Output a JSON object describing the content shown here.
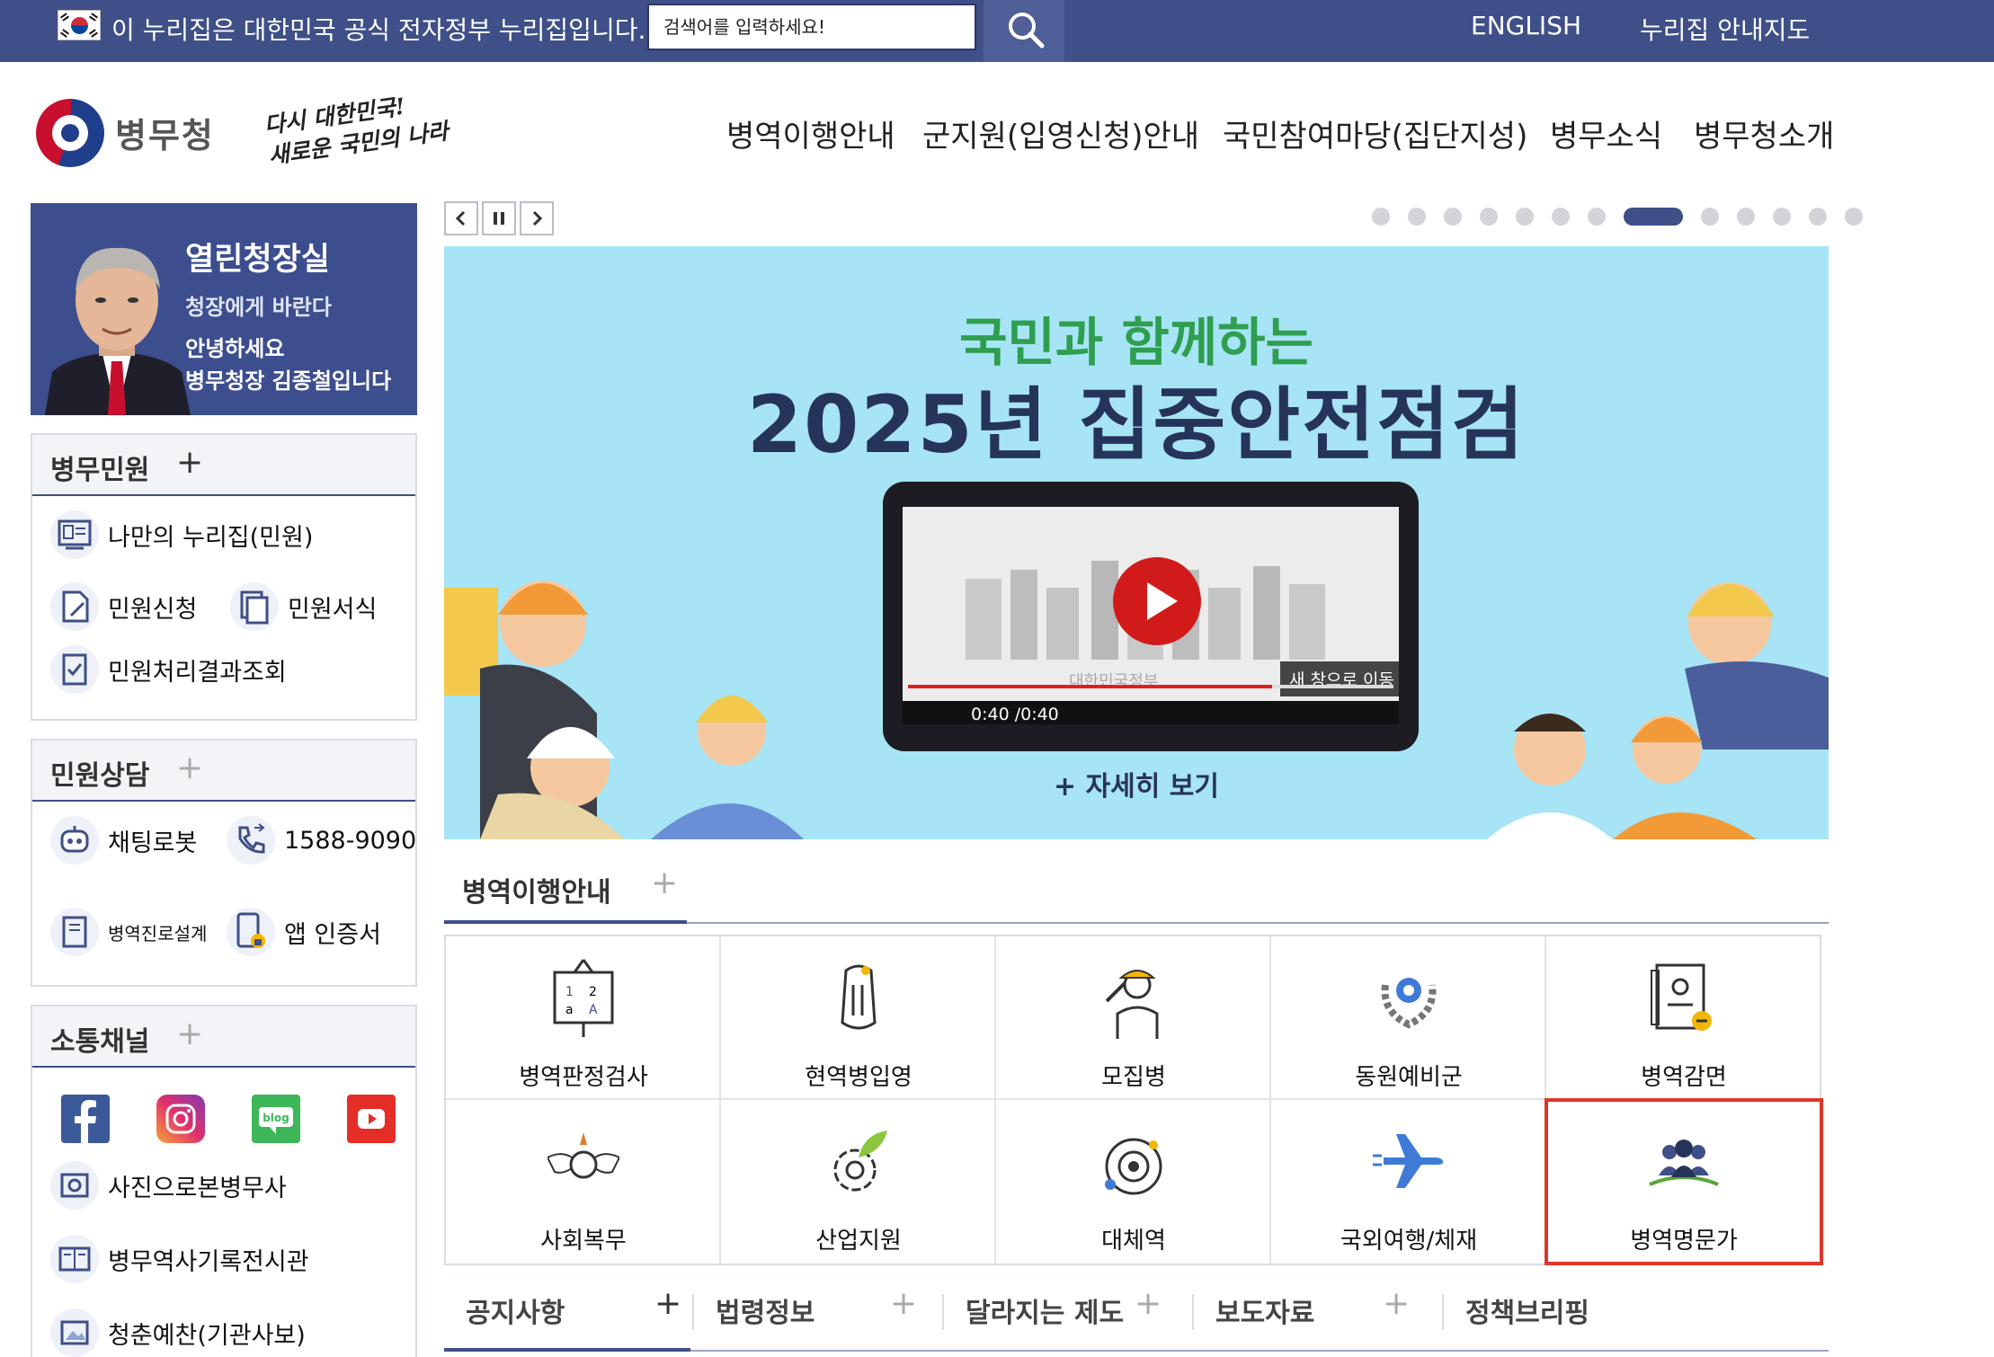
{
  "govbar": {
    "notice": "이 누리집은 대한민국 공식 전자정부 누리집입니다.",
    "search_placeholder": "검색어를 입력하세요!",
    "english": "ENGLISH",
    "sitemap": "누리집 안내지도",
    "bg_color": "#3f4f87"
  },
  "header": {
    "logo_text": "병무청",
    "slogan_line1": "다시 대한민국!",
    "slogan_line2": "새로운 국민의 나라",
    "nav": [
      "병역이행안내",
      "군지원(입영신청)안내",
      "국민참여마당(집단지성)",
      "병무소식",
      "병무청소개"
    ]
  },
  "chief": {
    "title": "열린청장실",
    "subtitle": "청장에게 바란다",
    "greeting1": "안녕하세요",
    "greeting2": "병무청장 김종철입니다"
  },
  "civil": {
    "title": "병무민원",
    "items": [
      "나만의 누리집(민원)",
      "민원신청",
      "민원서식",
      "민원처리결과조회"
    ]
  },
  "consult": {
    "title": "민원상담",
    "items": [
      "채팅로봇",
      "1588-9090",
      "병역진로설계",
      "앱 인증서"
    ]
  },
  "channel": {
    "title": "소통채널",
    "sns": [
      "facebook-icon",
      "instagram-icon",
      "blog-icon",
      "youtube-icon"
    ],
    "blog_label": "blog",
    "items": [
      "사진으로본병무사",
      "병무역사기록전시관",
      "청춘예찬(기관사보)"
    ]
  },
  "carousel": {
    "total_slides": 13,
    "active_slide": 8,
    "headline1": "국민과 함께하는",
    "headline2": "2025년 집중안전점검",
    "video_time": "0:40 /0:40",
    "video_progress": 0.75,
    "video_watermark": "대한민국정부",
    "new_window": "새 창으로 이동",
    "more": "+ 자세히 보기"
  },
  "service_tab": {
    "title": "병역이행안내",
    "plus": "+"
  },
  "services": [
    "병역판정검사",
    "현역병입영",
    "모집병",
    "동원예비군",
    "병역감면",
    "사회복무",
    "산업지원",
    "대체역",
    "국외여행/체재",
    "병역명문가"
  ],
  "bottom_tabs": [
    "공지사항",
    "법령정보",
    "달라지는 제도",
    "보도자료",
    "정책브리핑"
  ]
}
